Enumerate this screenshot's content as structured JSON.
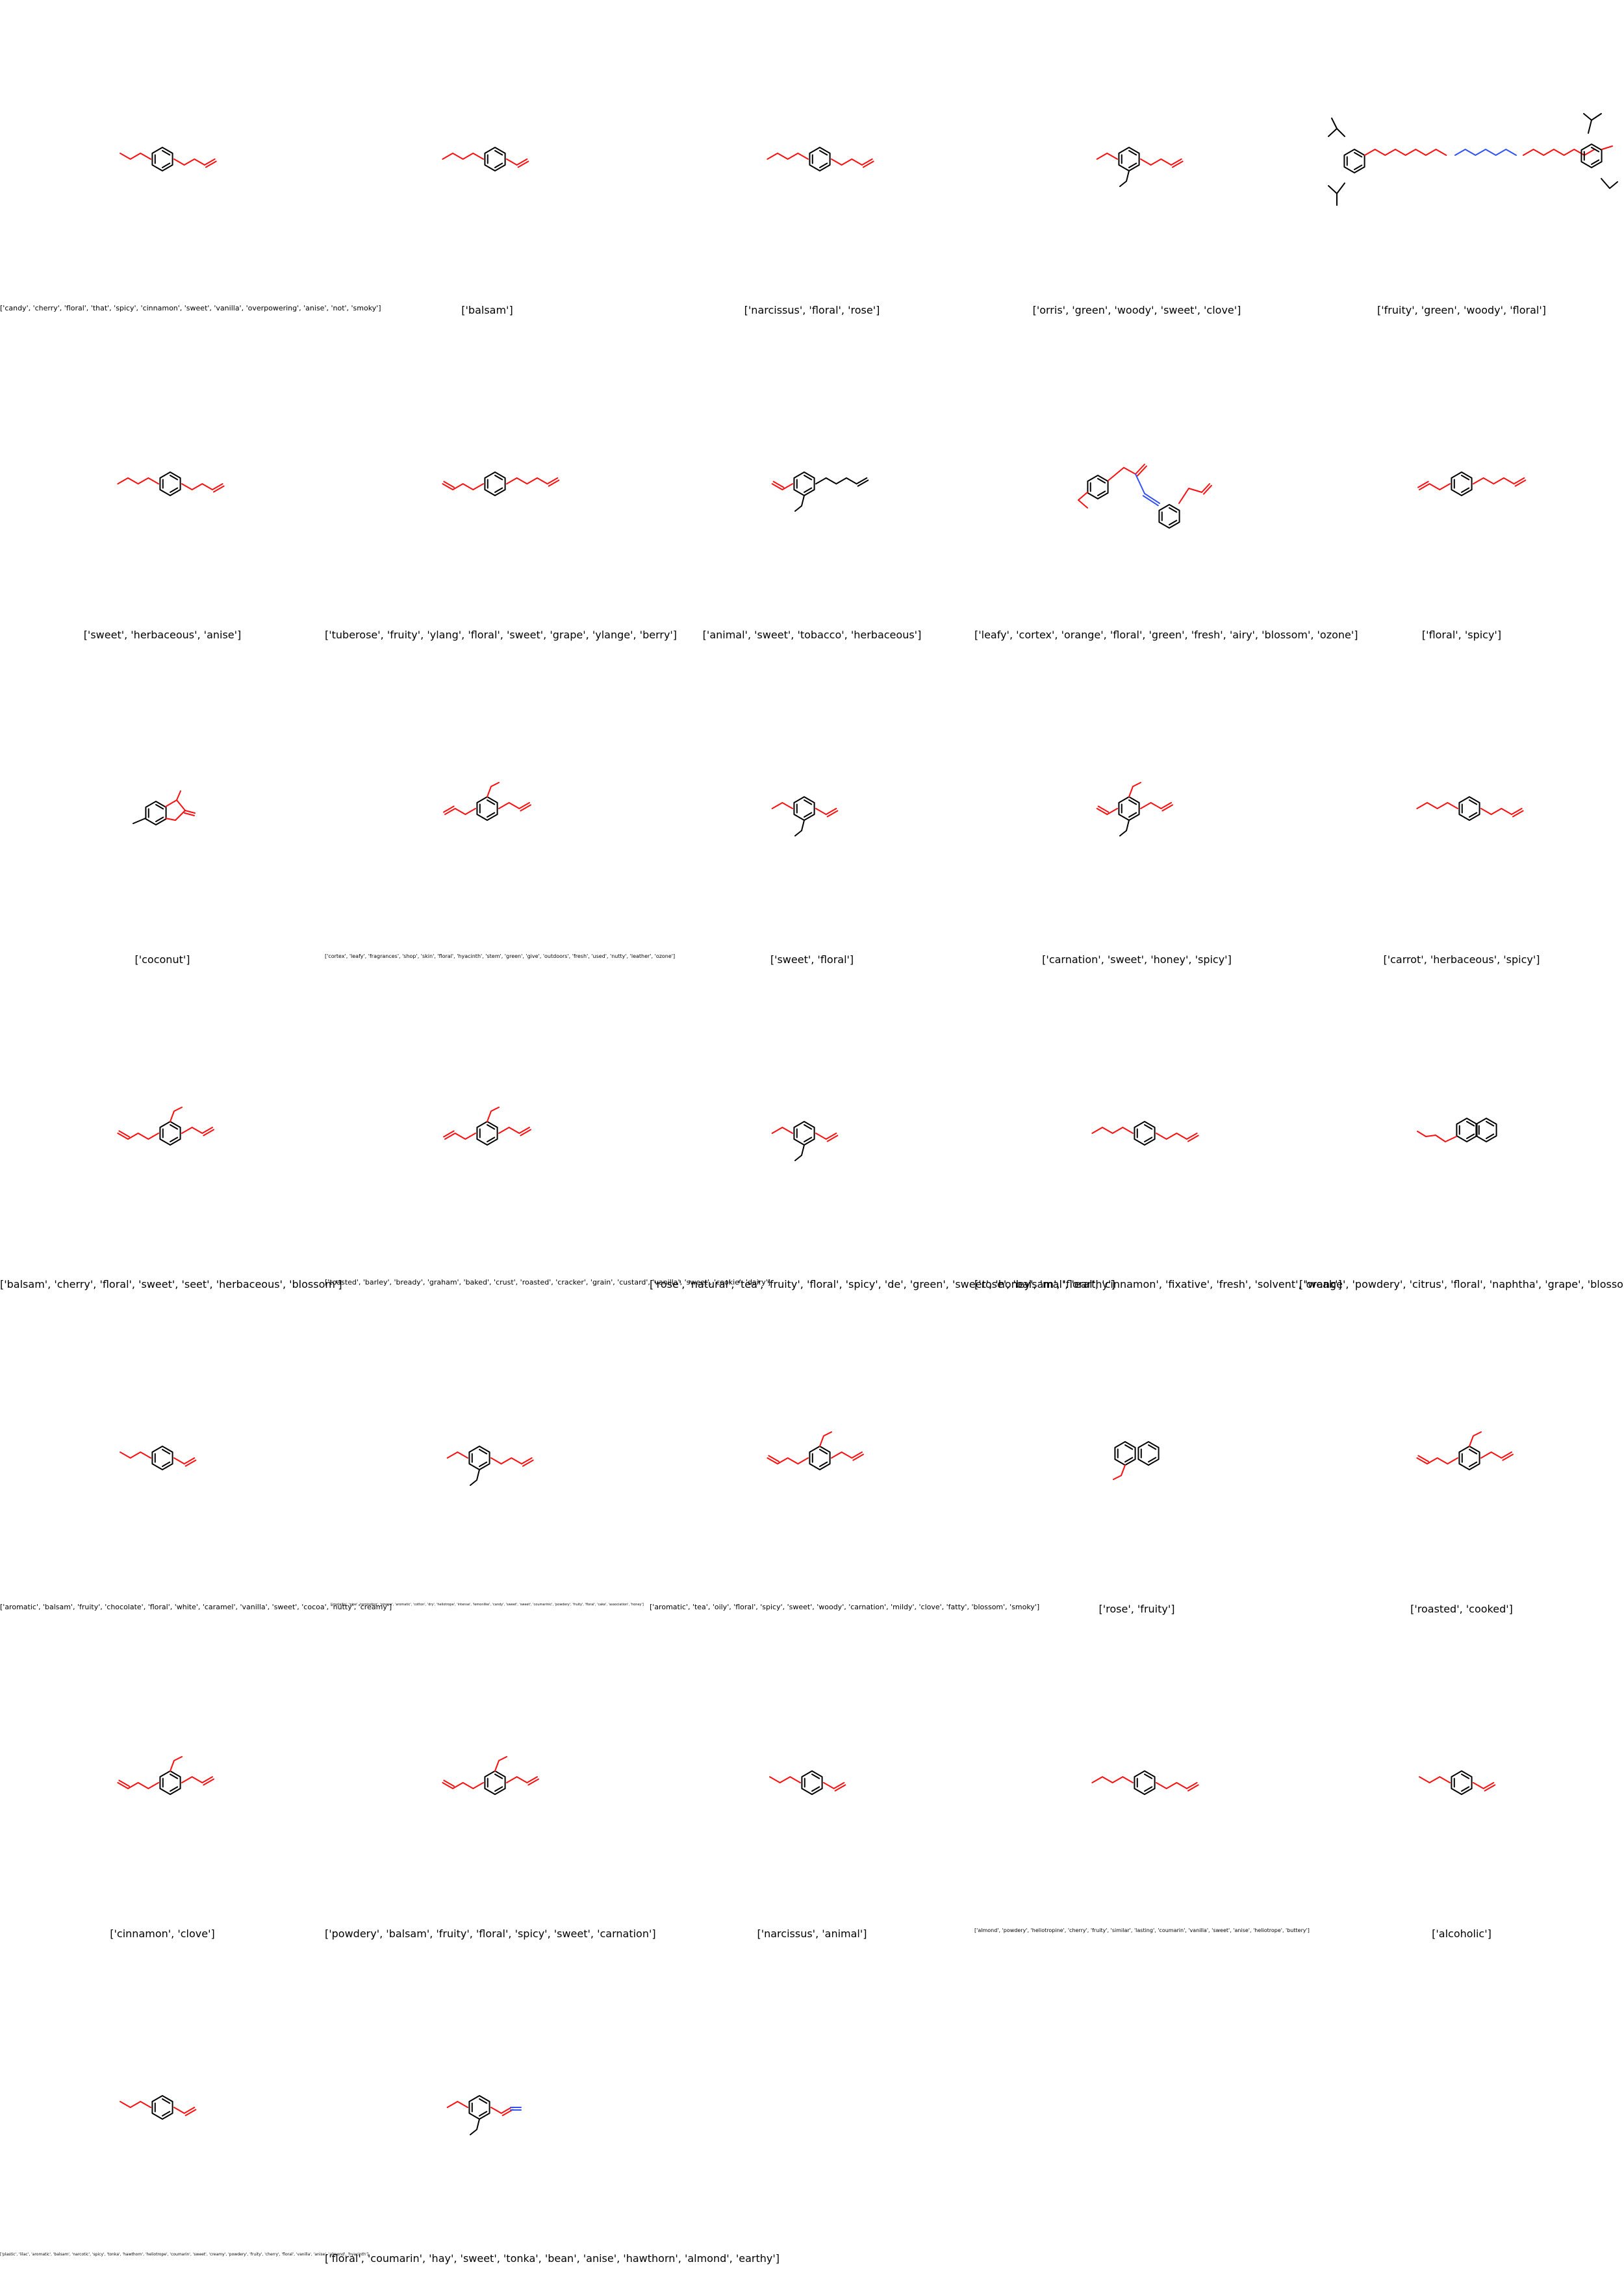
{
  "grid": {
    "columns": 5,
    "items": [
      {
        "label": "['candy', 'cherry', 'floral', 'that', 'spicy', 'cinnamon', 'sweet', 'vanilla', 'overpowering', 'anise', 'not', 'smoky']",
        "font": 11,
        "mol": "cinnamaldehyde-methoxy"
      },
      {
        "label": "['balsam']",
        "font": 16,
        "mol": "coumaric"
      },
      {
        "label": "['narcissus', 'floral', 'rose']",
        "font": 16,
        "mol": "diphenyl-ether"
      },
      {
        "label": "['orris', 'green', 'woody', 'sweet', 'clove']",
        "font": 16,
        "mol": "isoeugenyl-formate"
      },
      {
        "label": "['fruity', 'green', 'woody', 'floral']",
        "font": 16,
        "mol": "big-dimer"
      },
      {
        "label": "['sweet', 'herbaceous', 'anise']",
        "font": 16,
        "mol": "methyl-anisate"
      },
      {
        "label": "['tuberose', 'fruity', 'ylang', 'floral', 'sweet', 'grape', 'ylange', 'berry']",
        "font": 16,
        "mol": "methyl-salicylate-ether"
      },
      {
        "label": "['animal', 'sweet', 'tobacco', 'herbaceous']",
        "font": 16,
        "mol": "cresyl-malonate"
      },
      {
        "label": "['leafy', 'cortex', 'orange', 'floral', 'green', 'fresh', 'airy', 'blossom', 'ozone']",
        "font": 16,
        "mol": "schiff-base"
      },
      {
        "label": "['floral', 'spicy']",
        "font": 16,
        "mol": "trimethoxy-propenyl"
      },
      {
        "label": "['coconut']",
        "font": 16,
        "mol": "lactone"
      },
      {
        "label": "['cortex', 'leafy', 'fragrances', 'shop', 'skin', 'floral', 'hyacinth', 'stem', 'green', 'give', 'outdoors', 'fresh', 'used', 'nutty', 'leather', 'ozone']",
        "font": 8,
        "mol": "phenoxy-allyl"
      },
      {
        "label": "['sweet', 'floral']",
        "font": 16,
        "mol": "phenyl-ester"
      },
      {
        "label": "['carnation', 'sweet', 'honey', 'spicy']",
        "font": 16,
        "mol": "phenylacetate-eugenyl"
      },
      {
        "label": "['carrot', 'herbaceous', 'spicy']",
        "font": 16,
        "mol": "toluate-ethoxy"
      },
      {
        "label": "['balsam', 'cherry', 'floral', 'sweet', 'seet', 'herbaceous', 'blossom']",
        "font": 16,
        "mol": "salicylate-glycol"
      },
      {
        "label": "['toasted', 'barley', 'bready', 'graham', 'baked', 'crust', 'roasted', 'cracker', 'grain', 'custard', 'vanilla', 'sweet', 'cookie', 'dairy']",
        "font": 11,
        "mol": "ferulaldehyde"
      },
      {
        "label": "['rose', 'natural', 'tea', 'fruity', 'floral', 'spicy', 'de', 'green', 'sweet', 'honey', 'mal', 'earthy']",
        "font": 16,
        "mol": "anisyl-ether"
      },
      {
        "label": "['rose', 'balsam', 'floral', 'cinnamon', 'fixative', 'fresh', 'solvent', 'weak']",
        "font": 16,
        "mol": "phenoxyethanol"
      },
      {
        "label": "['orange', 'powdery', 'citrus', 'floral', 'naphtha', 'grape', 'blossom', 'naphthyl']",
        "font": 16,
        "mol": "naphthyl-ether"
      },
      {
        "label": "['aromatic', 'balsam', 'fruity', 'chocolate', 'floral', 'white', 'caramel', 'vanilla', 'sweet', 'cocoa', 'nutty', 'creamy']",
        "font": 11,
        "mol": "vanillin-oxalate"
      },
      {
        "label": "['metallic', 'pine', 'reminding', 'pinene', 'aromatic', 'cotton', 'dry', 'heliotrope', 'intense', 'lemonlike', 'candy', 'sweet', 'sweet', 'coumarinic', 'powdery', 'fruity', 'floral', 'cake', 'association', 'honey']",
        "font": 5,
        "mol": "piperonyl-propenal"
      },
      {
        "label": "['aromatic', 'tea', 'oily', 'floral', 'spicy', 'sweet', 'woody', 'carnation', 'mildy', 'clove', 'fatty', 'blossom', 'smoky']",
        "font": 11,
        "mol": "methyl-isoeugenol"
      },
      {
        "label": "['rose', 'fruity']",
        "font": 16,
        "mol": "biphenyl-ol"
      },
      {
        "label": "['roasted', 'cooked']",
        "font": 16,
        "mol": "anisate-glycolate"
      },
      {
        "label": "['cinnamon', 'clove']",
        "font": 16,
        "mol": "eugenyl-cinnamate"
      },
      {
        "label": "['powdery', 'balsam', 'fruity', 'floral', 'spicy', 'sweet', 'carnation']",
        "font": 16,
        "mol": "acetyl-isoeugenol"
      },
      {
        "label": "['narcissus', 'animal']",
        "font": 16,
        "mol": "cresyl-butenoate"
      },
      {
        "label": "['almond', 'powdery', 'heliotropine', 'cherry', 'fruity', 'similar', 'lasting', 'coumarin', 'vanilla', 'sweet', 'anise', 'heliotrope', 'buttery']",
        "font": 8,
        "mol": "anisal-acetone"
      },
      {
        "label": "['alcoholic']",
        "font": 16,
        "mol": "tert-butyl-ether"
      },
      {
        "label": "['plastic', 'lilac', 'aromatic', 'balsam', 'narcotic', 'spicy', 'tonka', 'hawthorn', 'heliotrope', 'coumarin', 'sweet', 'creamy', 'powdery', 'fruity', 'cherry', 'floral', 'vanilla', 'anise', 'almond', 'hyacinth']",
        "font": 6,
        "mol": "anisyl-carbonate"
      },
      {
        "label": "['floral', 'coumarin', 'hay', 'sweet', 'tonka', 'bean', 'anise', 'hawthorn', 'almond', 'earthy']",
        "font": 16,
        "mol": "anisonitrile"
      }
    ]
  }
}
